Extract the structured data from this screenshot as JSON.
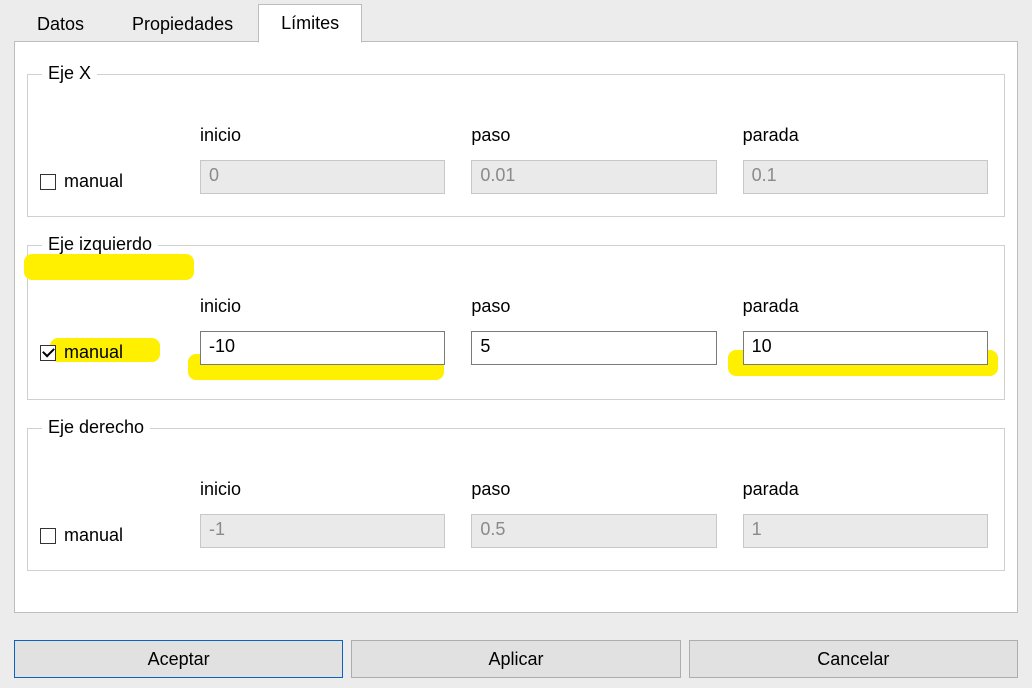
{
  "tabs": {
    "datos": "Datos",
    "propiedades": "Propiedades",
    "limites": "Límites"
  },
  "labels": {
    "manual": "manual",
    "inicio": "inicio",
    "paso": "paso",
    "parada": "parada"
  },
  "groups": {
    "ejeX": {
      "title": "Eje X",
      "manual_checked": false,
      "inicio": "0",
      "paso": "0.01",
      "parada": "0.1"
    },
    "ejeIzq": {
      "title": "Eje izquierdo",
      "manual_checked": true,
      "inicio": "-10",
      "paso": "5",
      "parada": "10"
    },
    "ejeDer": {
      "title": "Eje derecho",
      "manual_checked": false,
      "inicio": "-1",
      "paso": "0.5",
      "parada": "1"
    }
  },
  "buttons": {
    "aceptar": "Aceptar",
    "aplicar": "Aplicar",
    "cancelar": "Cancelar"
  }
}
